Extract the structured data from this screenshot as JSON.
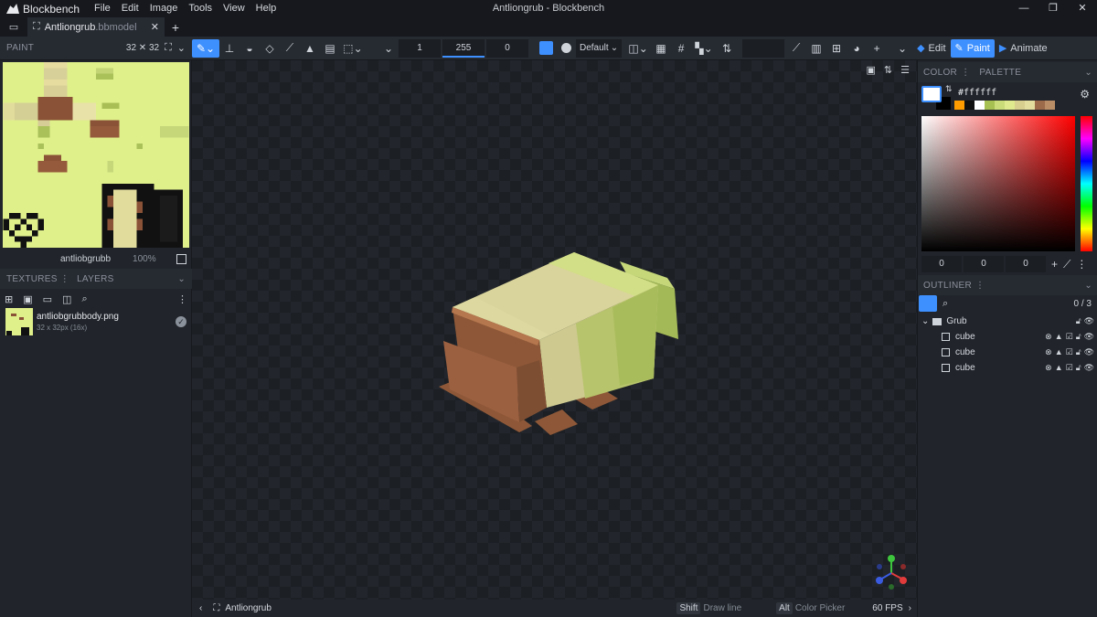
{
  "app": {
    "name": "Blockbench",
    "window_title": "Antliongrub - Blockbench",
    "menu": [
      "File",
      "Edit",
      "Image",
      "Tools",
      "View",
      "Help"
    ]
  },
  "tab": {
    "name": "Antliongrub",
    "ext": ".bbmodel"
  },
  "toolbar": {
    "paint_label": "PAINT",
    "paint_size": "32 ✕ 32",
    "brush_size": "1",
    "opacity": "255",
    "softness": "0",
    "blend_mode": "Default",
    "modes": {
      "edit": "Edit",
      "paint": "Paint",
      "animate": "Animate"
    }
  },
  "uv": {
    "texture_name": "antliobgrubb",
    "zoom": "100%"
  },
  "textures_panel": {
    "tab_textures": "TEXTURES",
    "tab_layers": "LAYERS",
    "item": {
      "name": "antliobgrubbody.png",
      "detail": "32 x 32px (16x)"
    }
  },
  "color_panel": {
    "tab_color": "COLOR",
    "tab_palette": "PALETTE",
    "hex": "#ffffff",
    "primary": "#ffffff",
    "secondary": "#000000",
    "palette": [
      "#ff9c00",
      "#101010",
      "#ffffff",
      "#a6c052",
      "#c9dc79",
      "#dfe98e",
      "#d7cf8e",
      "#e3dd9e",
      "#9c6b4a",
      "#b98e66"
    ],
    "r": "0",
    "g": "0",
    "b": "0"
  },
  "outliner": {
    "title": "OUTLINER",
    "count": "0 / 3",
    "group": "Grub",
    "items": [
      {
        "name": "cube"
      },
      {
        "name": "cube"
      },
      {
        "name": "cube"
      }
    ]
  },
  "statusbar": {
    "project": "Antliongrub",
    "shift_key": "Shift",
    "shift_hint": "Draw line",
    "alt_key": "Alt",
    "alt_hint": "Color Picker",
    "fps": "60 FPS"
  }
}
